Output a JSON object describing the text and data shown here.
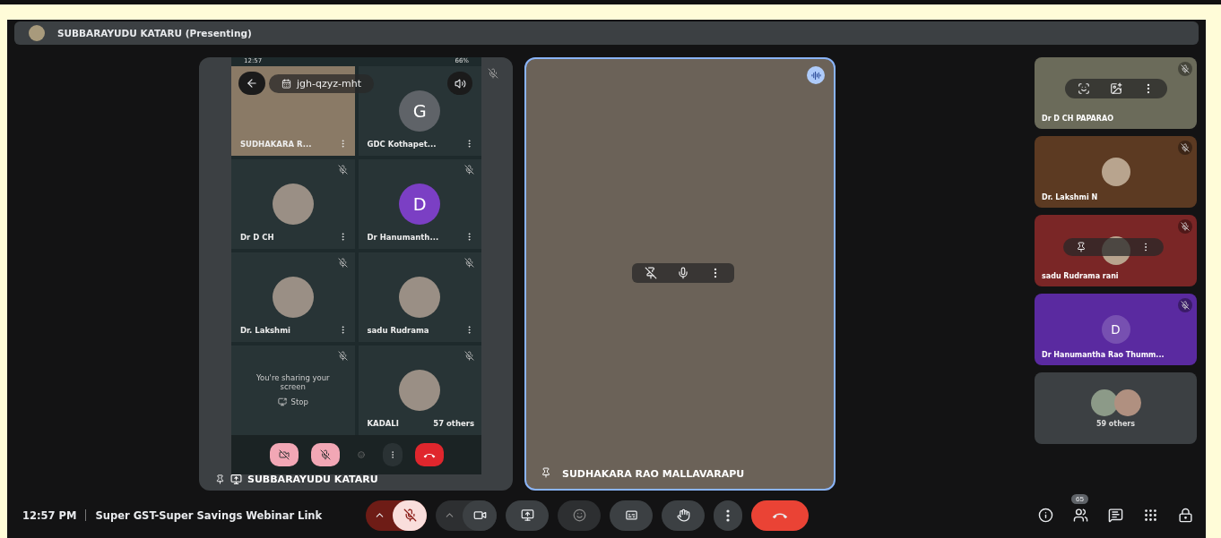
{
  "presenter_bar": {
    "title": "SUBBARAYUDU KATARU (Presenting)"
  },
  "shared_screen": {
    "muted": true,
    "label": "SUBBARAYUDU KATARU",
    "status_time": "12:57",
    "battery": "66%",
    "meeting_code": "jgh-qzyz-mht",
    "tiles": [
      {
        "kind": "video",
        "name": "SUDHAKARA R...",
        "muted": false
      },
      {
        "kind": "letter",
        "name": "GDC Kothapet...",
        "letter": "G",
        "color": "#5f6368",
        "muted": false
      },
      {
        "kind": "avatar",
        "name": "Dr D CH",
        "muted": true
      },
      {
        "kind": "letter",
        "name": "Dr Hanumanth...",
        "letter": "D",
        "color": "#7b3fc4",
        "muted": true
      },
      {
        "kind": "avatar",
        "name": "Dr. Lakshmi",
        "muted": true
      },
      {
        "kind": "avatar",
        "name": "sadu Rudrama",
        "muted": true
      },
      {
        "kind": "sharing",
        "text": "You're sharing your screen",
        "button": "Stop",
        "muted": true
      },
      {
        "kind": "avatar",
        "name": "KADALI",
        "extra": "57 others",
        "muted": true
      }
    ]
  },
  "speaker": {
    "name": "SUDHAKARA RAO MALLAVARAPU",
    "speaking": true
  },
  "side_tiles": [
    {
      "kind": "video",
      "name": "Dr D CH PAPARAO",
      "color": "#6b6b5a",
      "muted": true
    },
    {
      "kind": "avatar",
      "name": "Dr. Lakshmi N",
      "color": "#5c3a22",
      "muted": true
    },
    {
      "kind": "avatar",
      "name": "sadu Rudrama rani",
      "color": "#7a2626",
      "muted": true
    },
    {
      "kind": "letter",
      "name": "Dr Hanumantha Rao Thumm...",
      "letter": "D",
      "color": "#5a2aa0",
      "muted": true
    },
    {
      "kind": "group",
      "name": "59 others",
      "color": "#3c4043",
      "muted": false
    }
  ],
  "bottom_bar": {
    "time": "12:57 PM",
    "meeting_title": "Super GST-Super Savings Webinar Link",
    "mic_muted": true,
    "camera_muted": false,
    "people_count": "65"
  }
}
